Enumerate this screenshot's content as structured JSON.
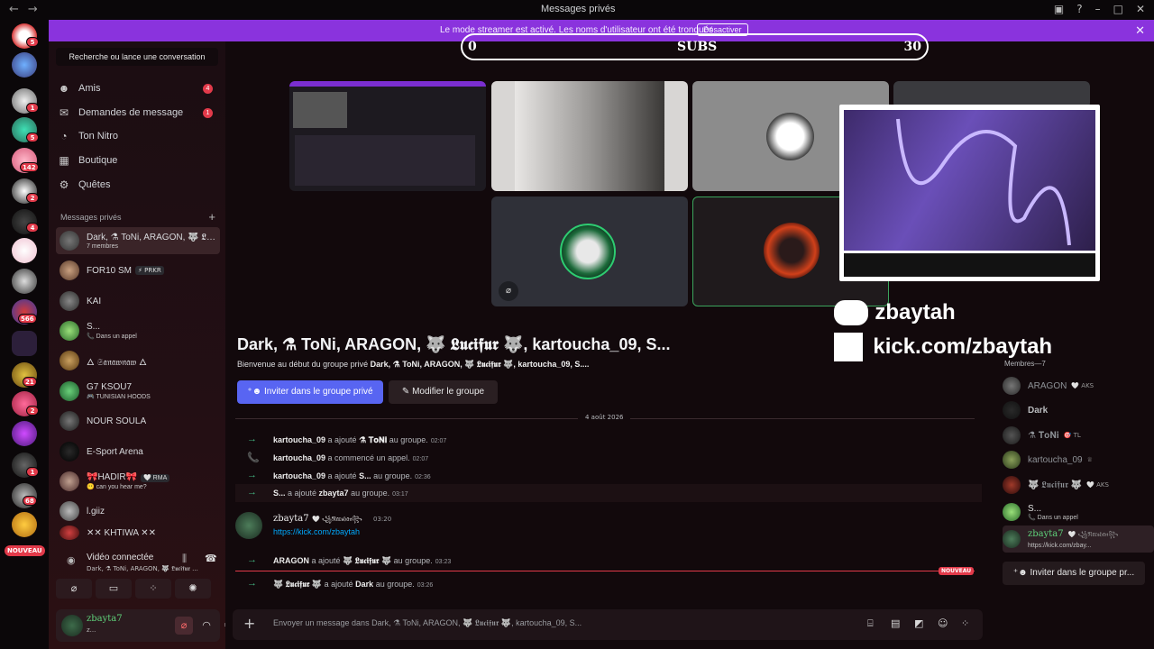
{
  "window": {
    "title": "Messages privés",
    "back_icon": "arrow-left-icon",
    "forward_icon": "arrow-right-icon"
  },
  "streamer_banner": {
    "message": "Le mode streamer est activé. Les noms d'utilisateur ont été tronqués.",
    "button": "Désactiver",
    "close": "✕",
    "color": "#8a33dd"
  },
  "guilds": {
    "badges": [
      "5",
      "1",
      "5",
      "142",
      "2",
      "4",
      "566",
      "21",
      "2",
      "1",
      "68"
    ],
    "new_label": "NOUVEAU"
  },
  "sidebar": {
    "search_label": "Recherche ou lance une conversation",
    "nav": [
      {
        "label": "Amis",
        "icon": "friends-icon",
        "badge": "4"
      },
      {
        "label": "Demandes de message",
        "icon": "mail-icon",
        "badge": "1"
      },
      {
        "label": "Ton Nitro",
        "icon": "nitro-icon",
        "badge": ""
      },
      {
        "label": "Boutique",
        "icon": "shop-icon",
        "badge": ""
      },
      {
        "label": "Quêtes",
        "icon": "quests-icon",
        "badge": ""
      }
    ],
    "dm_header": "Messages privés",
    "dms": [
      {
        "name": "Dark, ⚗ ToNi, ARAGON, 🐺 𝕷…",
        "sub": "7 membres",
        "tag": ""
      },
      {
        "name": "FOR10 SM",
        "sub": "",
        "tag": "⚡ PRKR"
      },
      {
        "name": "KAI",
        "sub": "",
        "tag": ""
      },
      {
        "name": "S...",
        "sub": "📞 Dans un appel",
        "tag": ""
      },
      {
        "name": "🜂 𝔖𝔞𝔫𝔞𝔴𝔫𝔞𝔴 🜂",
        "sub": "",
        "tag": ""
      },
      {
        "name": "G7 KSOU7",
        "sub": "🎮 TUNISIAN HOODS",
        "tag": ""
      },
      {
        "name": "NOUR SOULA",
        "sub": "",
        "tag": ""
      },
      {
        "name": "E-Sport Arena",
        "sub": "",
        "tag": ""
      },
      {
        "name": "🎀HADIR🎀",
        "sub": "😶 can you hear me?",
        "tag": "🤍 RMA"
      },
      {
        "name": "l.giiz",
        "sub": "",
        "tag": ""
      },
      {
        "name": "✕✕ KHTIWA ✕✕",
        "sub": "",
        "tag": ""
      }
    ],
    "voice": {
      "title": "Vidéo connectée",
      "subtitle": "Dark, ⚗ ToNi, ARAGON, 🐺 𝕷𝖚𝖈𝖎𝖋𝖚𝖗 ...",
      "buttons": [
        "camera-off-icon",
        "screen-share-icon",
        "activities-icon",
        "soundboard-icon"
      ]
    },
    "user": {
      "name": "zbayta7",
      "status": "z..."
    }
  },
  "overlay": {
    "sub_min": "0",
    "sub_label": "SUBS",
    "sub_max": "30",
    "discord_handle": "zbaytah",
    "kick_handle": "kick.com/zbaytah"
  },
  "chat": {
    "group_title": "Dark, ⚗ ToNi, ARAGON, 🐺 𝕷𝖚𝖈𝖎𝖋𝖚𝖗 🐺, kartoucha_09, S...",
    "welcome_prefix": "Bienvenue au début du groupe privé",
    "welcome_names": "Dark, ⚗ ToNi, ARAGON, 🐺 𝕷𝖚𝖈𝖎𝖋𝖚𝖗 🐺, kartoucha_09, S....",
    "invite_button": "Inviter dans le groupe privé",
    "edit_button": "Modifier le groupe",
    "date": "4 août 2026",
    "system": [
      {
        "icon": "→",
        "actor": "kartoucha_09",
        "action": " a ajouté ",
        "target": "⚗ 𝐓𝐨𝐍𝐢",
        "suffix": " au groupe.",
        "time": "02:07"
      },
      {
        "icon": "📞",
        "actor": "kartoucha_09",
        "action": " a commencé un appel.",
        "target": "",
        "suffix": "",
        "time": "02:07"
      },
      {
        "icon": "→",
        "actor": "kartoucha_09",
        "action": " a ajouté ",
        "target": "S...",
        "suffix": " au groupe.",
        "time": "02:36"
      },
      {
        "icon": "→",
        "actor": "S...",
        "action": " a ajouté ",
        "target": "zbayta7",
        "suffix": " au groupe.",
        "time": "03:17"
      }
    ],
    "message": {
      "author": "zbayta7",
      "decoration": "🤍 ꧁𝔑𝔞𝔯𝔰𝔥𝔞𝔫꧂",
      "time": "03:20",
      "text": "https://kick.com/zbaytah"
    },
    "system2": [
      {
        "icon": "→",
        "actor": "ARAGON",
        "action": " a ajouté ",
        "target": "🐺 𝕷𝖚𝖈𝖎𝖋𝖚𝖗 🐺",
        "suffix": " au groupe.",
        "time": "03:23"
      },
      {
        "icon": "→",
        "actor": "🐺 𝕷𝖚𝖈𝖎𝖋𝖚𝖗 🐺",
        "action": " a ajouté ",
        "target": "Dark",
        "suffix": " au groupe.",
        "time": "03:26"
      }
    ],
    "new_label": "NOUVEAU",
    "composer_placeholder": "Envoyer un message dans Dark, ⚗ ToNi, ARAGON, 🐺 𝕷𝖚𝖈𝖎𝖋𝖚𝖗 🐺, kartoucha_09, S...",
    "composer_icons": [
      "gift-icon",
      "gif-icon",
      "sticker-icon",
      "emoji-icon",
      "apps-icon"
    ]
  },
  "members": {
    "header": "Membres—7",
    "list": [
      {
        "name": "ARAGON",
        "sub": "",
        "tag": "🤍 AKS",
        "color": "#8e9297"
      },
      {
        "name": "Dark",
        "sub": "",
        "tag": "",
        "color": "#b9bbbe"
      },
      {
        "name": "⚗ 𝐓𝐨𝐍𝐢",
        "sub": "",
        "tag": "🎯 TL",
        "color": "#8e9297"
      },
      {
        "name": "kartoucha_09",
        "sub": "",
        "tag": "♕",
        "color": "#8e9297"
      },
      {
        "name": "🐺 𝕷𝖚𝖈𝖎𝖋𝖚𝖗 🐺",
        "sub": "",
        "tag": "🤍 AKS",
        "color": "#8e9297"
      },
      {
        "name": "S...",
        "sub": "📞 Dans un appel",
        "tag": "",
        "color": "#e0e0e0"
      },
      {
        "name": "zbayta7",
        "sub": "https://kick.com/zbay...",
        "tag": "🤍 ꧁𝔑𝔞𝔯𝔰𝔥𝔞𝔫꧂",
        "color": "#5fd17a"
      }
    ],
    "invite_button": "Inviter dans le groupe pr..."
  }
}
